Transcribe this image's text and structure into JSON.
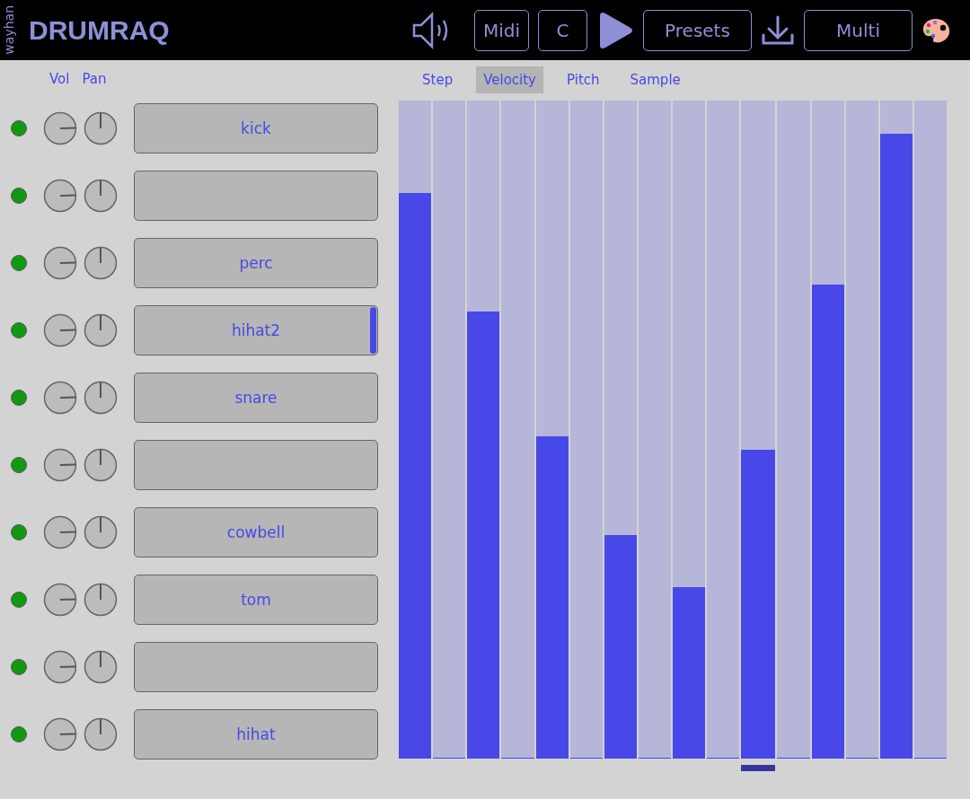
{
  "header": {
    "vendor": "wayhan",
    "title": "DRUMRAQ",
    "buttons": [
      {
        "kind": "speaker"
      },
      {
        "kind": "text",
        "label": "Midi"
      },
      {
        "kind": "text",
        "label": "C"
      },
      {
        "kind": "play"
      },
      {
        "kind": "text",
        "label": "Presets"
      },
      {
        "kind": "download"
      },
      {
        "kind": "text",
        "label": "Multi"
      },
      {
        "kind": "palette"
      }
    ]
  },
  "columns": {
    "vol": "Vol",
    "pan": "Pan"
  },
  "tracks": [
    {
      "name": "kick",
      "on": true,
      "selected": false
    },
    {
      "on": true,
      "selected": false
    },
    {
      "name": "perc",
      "on": true,
      "selected": false
    },
    {
      "name": "hihat2",
      "on": true,
      "selected": true
    },
    {
      "name": "snare",
      "on": true,
      "selected": false
    },
    {
      "on": true,
      "selected": false
    },
    {
      "name": "cowbell",
      "on": true,
      "selected": false
    },
    {
      "name": "tom",
      "on": true,
      "selected": false
    },
    {
      "on": true,
      "selected": false
    },
    {
      "name": "hihat",
      "on": true,
      "selected": false
    }
  ],
  "tabs": [
    {
      "label": "Step",
      "selected": false
    },
    {
      "label": "Velocity",
      "selected": true
    },
    {
      "label": "Pitch",
      "selected": false
    },
    {
      "label": "Sample",
      "selected": false
    }
  ],
  "steps": [
    {
      "level": 0.86,
      "current": false
    },
    {
      "level": 0,
      "current": false
    },
    {
      "level": 0.68,
      "current": false
    },
    {
      "level": 0,
      "current": false
    },
    {
      "level": 0.49,
      "current": false
    },
    {
      "level": 0,
      "current": false
    },
    {
      "level": 0.34,
      "current": false
    },
    {
      "level": 0,
      "current": false
    },
    {
      "level": 0.26,
      "current": false
    },
    {
      "level": 0,
      "current": false
    },
    {
      "level": 0.47,
      "current": true
    },
    {
      "level": 0,
      "current": false
    },
    {
      "level": 0.72,
      "current": false
    },
    {
      "level": 0,
      "current": false
    },
    {
      "level": 0.95,
      "current": false
    },
    {
      "level": 0,
      "current": false
    }
  ]
}
